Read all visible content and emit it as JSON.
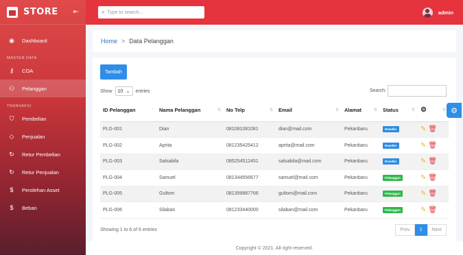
{
  "brand": {
    "name": "STORE"
  },
  "sidebar": {
    "sections": [
      "MASTER DATA",
      "TRANSAKSI"
    ],
    "dashboard": "Dashboard",
    "coa": "COA",
    "pelanggan": "Pelanggan",
    "pembelian": "Pembelian",
    "penjualan": "Penjualan",
    "retur_pembelian": "Retur Pembelian",
    "retur_penjualan": "Retur Penjualan",
    "perolehan_asset": "Perolehan Asset",
    "beban": "Beban"
  },
  "topbar": {
    "search_placeholder": "Type to search...",
    "user": "admin"
  },
  "breadcrumb": {
    "home": "Home",
    "current": "Data Pelanggan"
  },
  "card": {
    "add_button": "Tambah",
    "show_label": "Show",
    "show_value": "10",
    "entries_label": "entries",
    "search_label": "Search:",
    "info": "Showing 1 to 6 of 6 entries",
    "prev": "Prev",
    "page": "1",
    "next": "Next"
  },
  "table": {
    "headers": [
      "ID Pelanggan",
      "Nama Pelanggan",
      "No Telp",
      "Email",
      "Alamat",
      "Status"
    ],
    "rows": [
      {
        "id": "PLG-001",
        "nama": "Dian",
        "telp": "081081081081",
        "email": "dian@mail.com",
        "alamat": "Pekanbaru",
        "status": "Reseller"
      },
      {
        "id": "PLG-002",
        "nama": "Aprita",
        "telp": "081235425412",
        "email": "aprita@mail.com",
        "alamat": "Pekanbaru",
        "status": "Reseller"
      },
      {
        "id": "PLG-003",
        "nama": "Salsabila",
        "telp": "085254512451",
        "email": "salsabila@mail.com",
        "alamat": "Pekanbaru",
        "status": "Reseller"
      },
      {
        "id": "PLG-004",
        "nama": "Samuel",
        "telp": "081344556677",
        "email": "samuel@mail.com",
        "alamat": "Pekanbaru",
        "status": "Pelanggan"
      },
      {
        "id": "PLG-005",
        "nama": "Gultom",
        "telp": "081399887766",
        "email": "gultom@mail.com",
        "alamat": "Pekanbaru",
        "status": "Pelanggan"
      },
      {
        "id": "PLG-006",
        "nama": "Silaban",
        "telp": "081233440000",
        "email": "silaban@mail.com",
        "alamat": "Pekanbaru",
        "status": "Pelanggan"
      }
    ]
  },
  "footer": {
    "text": "Copyright © 2021. All right reserved."
  },
  "colors": {
    "primary_red": "#e5343d",
    "blue": "#2f8ee6",
    "green": "#30b74a"
  }
}
